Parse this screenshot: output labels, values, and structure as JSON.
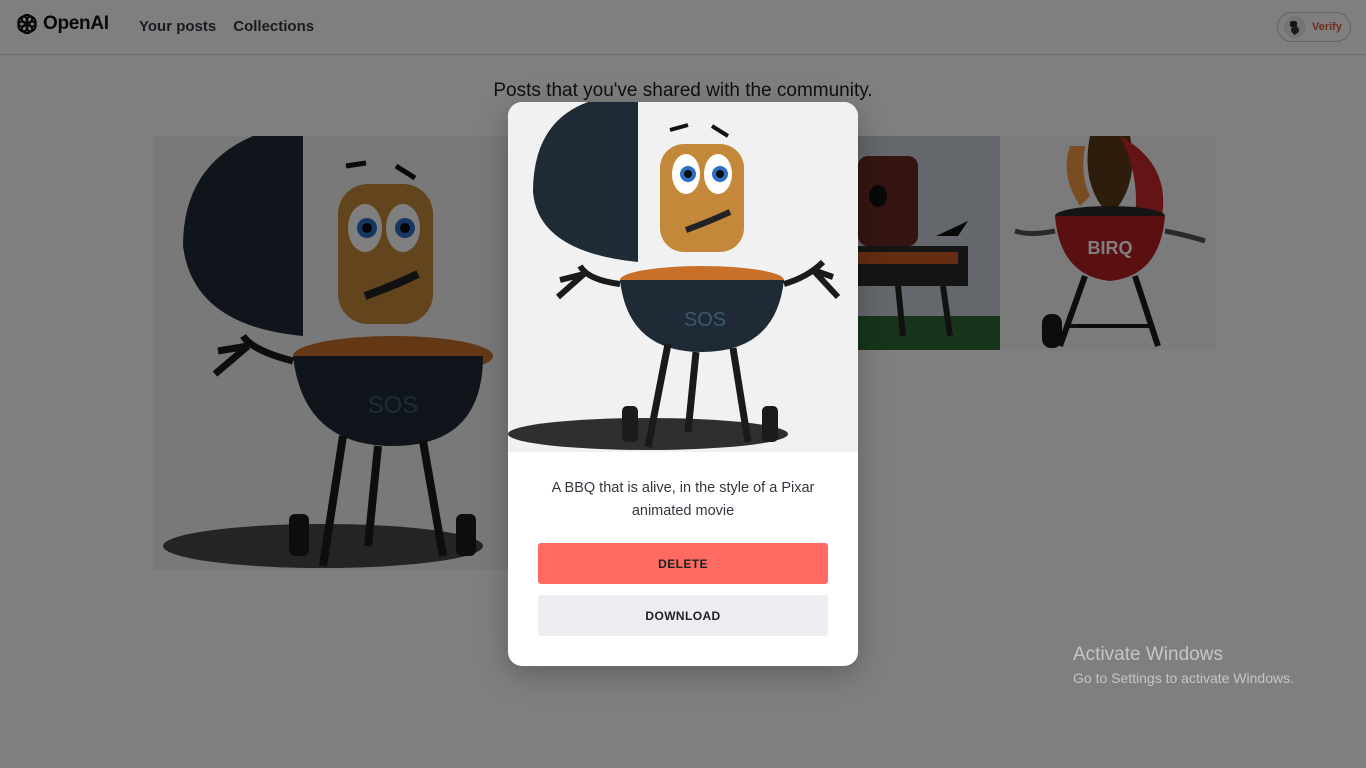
{
  "header": {
    "logo_text": "OpenAI",
    "logo_icon": "openai-logo-icon",
    "nav": [
      {
        "label": "Your posts"
      },
      {
        "label": "Collections"
      }
    ],
    "user": {
      "verify_label": "Verify",
      "avatar_icon": "user-avatar-icon"
    }
  },
  "page": {
    "subtitle": "Posts that you've shared with the community."
  },
  "posts": [
    {
      "kind": "bbq-sos-large"
    },
    {
      "kind": "bbq-grill-photo"
    },
    {
      "kind": "bbq-red-character",
      "label": "BIRQ"
    }
  ],
  "modal": {
    "image_text": "SOS",
    "caption": "A BBQ that is alive, in the style of a Pixar animated movie",
    "delete_label": "DELETE",
    "download_label": "DOWNLOAD"
  },
  "watermark": {
    "title": "Activate Windows",
    "subtitle": "Go to Settings to activate Windows."
  },
  "colors": {
    "delete_button": "#ff6b61",
    "download_button": "#ececf1",
    "verify_text": "#e05d3b",
    "overlay": "rgba(0,0,0,0.5)"
  }
}
